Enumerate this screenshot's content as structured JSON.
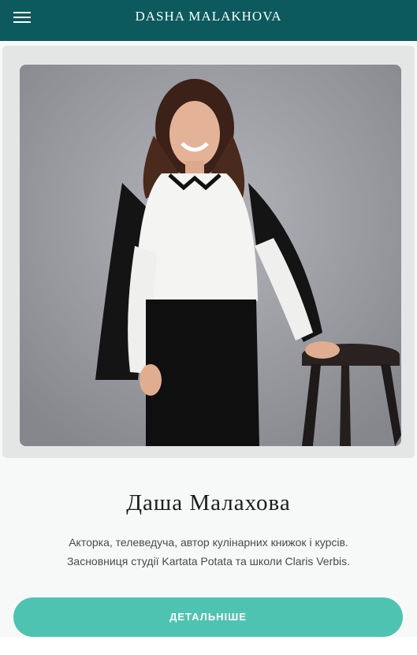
{
  "header": {
    "brand": "DASHA MALAKHOVA",
    "menu_icon": "hamburger-menu-icon",
    "background": "#0c5a5e"
  },
  "hero": {
    "name": "Даша Малахова",
    "description_line1": "Акторка, телеведуча, автор кулінарних книжок і курсів.",
    "description_line2": "Засновниця студії Kartata Potata та школи Claris Verbis.",
    "cta_label": "ДЕТАЛЬНІШЕ",
    "accent": "#4fc3b1"
  }
}
